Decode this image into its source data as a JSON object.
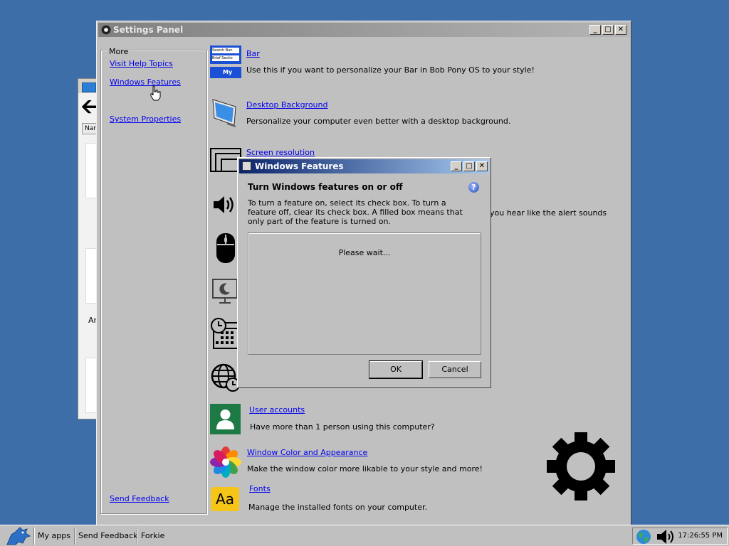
{
  "settings_window": {
    "title": "Settings Panel",
    "sidebar": {
      "legend": "More",
      "links": [
        "Visit Help Topics",
        "Windows Features",
        "System Properties"
      ],
      "feedback": "Send Feedback"
    },
    "items": [
      {
        "title": "Bar",
        "desc": "Use this if you want to personalize your Bar in Bob Pony OS to your style!"
      },
      {
        "title": "Desktop Background",
        "desc": "Personalize your computer even better with a desktop background."
      },
      {
        "title": "Screen resolution",
        "desc": ""
      },
      {
        "title": "",
        "desc": "you hear like the alert sounds"
      },
      {
        "title": "User accounts",
        "desc": "Have more than 1 person using this computer?"
      },
      {
        "title": "Window Color and Appearance",
        "desc": "Make the window color more likable to your style and more!"
      },
      {
        "title": "Fonts",
        "desc": "Manage the installed fonts on your computer."
      }
    ],
    "bar_icon_texts": [
      "Search Bun",
      "Brief Sectio",
      "My ap"
    ],
    "fonts_icon_text": "Aa"
  },
  "dialog": {
    "title": "Windows Features",
    "heading": "Turn Windows features on or off",
    "description": "To turn a feature on, select its check box. To turn a feature off, clear its check box. A filled box means that only part of the feature is turned on.",
    "status": "Please wait...",
    "ok": "OK",
    "cancel": "Cancel",
    "help": "?"
  },
  "background_window": {
    "tab_label": "Nar",
    "label": "Ar"
  },
  "taskbar": {
    "items": [
      "My apps",
      "Send Feedback",
      "Forkie"
    ],
    "clock": "17:26:55 PM"
  },
  "colors": {
    "desktop": "#3d6ea8",
    "window_face": "#c0c0c0",
    "active_title": "#0a246a",
    "link": "#0000ee"
  }
}
